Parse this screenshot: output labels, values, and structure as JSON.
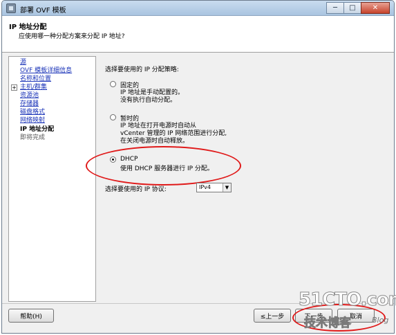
{
  "window": {
    "title": "部署 OVF 模板",
    "controls": {
      "minimize": "─",
      "maximize": "□",
      "close": "✕"
    }
  },
  "header": {
    "title": "IP 地址分配",
    "subtitle": "应使用哪一种分配方案来分配 IP 地址?"
  },
  "nav": {
    "items": [
      {
        "label": "源",
        "state": "link"
      },
      {
        "label": "OVF 模板详细信息",
        "state": "link"
      },
      {
        "label": "名称和位置",
        "state": "link"
      },
      {
        "label": "主机/群集",
        "state": "link",
        "expand": "+"
      },
      {
        "label": "资源池",
        "state": "link"
      },
      {
        "label": "存储器",
        "state": "link"
      },
      {
        "label": "磁盘格式",
        "state": "link"
      },
      {
        "label": "网络映射",
        "state": "link"
      },
      {
        "label": "IP 地址分配",
        "state": "current"
      },
      {
        "label": "即将完成",
        "state": "pending"
      }
    ]
  },
  "main": {
    "prompt": "选择要使用的 IP 分配策略:",
    "options": [
      {
        "label": "固定的",
        "desc": [
          "IP 地址是手动配置的。",
          "没有执行自动分配。"
        ],
        "checked": false
      },
      {
        "label": "暂时的",
        "desc": [
          "IP 地址在打开电源时自动从",
          "vCenter 管理的 IP 网络范围进行分配,",
          "在关闭电源时自动释放。"
        ],
        "checked": false
      },
      {
        "label": "DHCP",
        "desc": [
          "使用 DHCP 服务器进行 IP 分配。"
        ],
        "checked": true
      }
    ],
    "protocol_label": "选择要使用的 IP 协议:",
    "protocol_value": "IPv4"
  },
  "footer": {
    "help": "帮助(H)",
    "back": "≤上一步",
    "next": "下一步",
    "cancel": "取消"
  },
  "watermark": {
    "main": "51CTO.com",
    "sub": "技术博客",
    "blog": "Blog"
  },
  "colors": {
    "link": "#1a33b8",
    "annotation": "#e01a1a"
  }
}
